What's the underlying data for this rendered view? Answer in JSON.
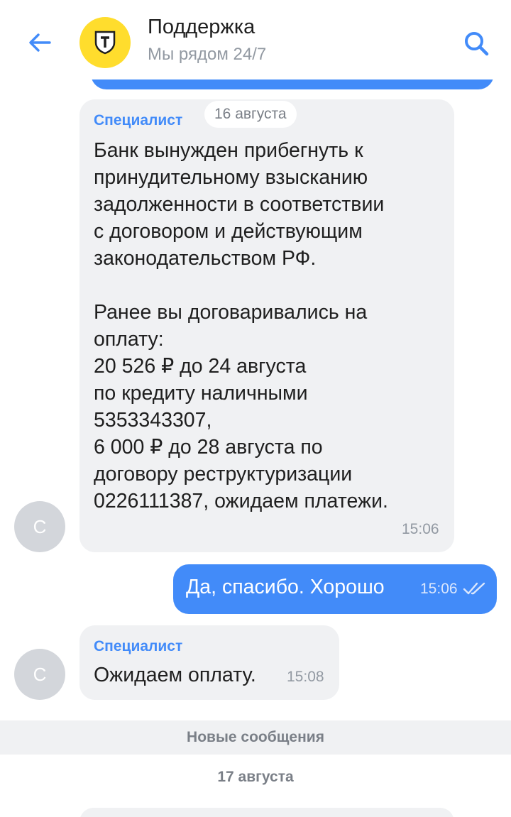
{
  "header": {
    "title": "Поддержка",
    "subtitle": "Мы рядом 24/7",
    "back_icon": "arrow-left-icon",
    "search_icon": "search-icon",
    "logo_icon": "tinkoff-shield-icon"
  },
  "colors": {
    "accent": "#428bf9",
    "bubble_in": "#f0f1f3",
    "logo_bg": "#ffdd2d",
    "avatar_bg": "#d3d6db"
  },
  "messages": [
    {
      "sender": "Специалист",
      "date_chip": "16 августа",
      "text": "Банк вынужден прибегнуть к\nпринудительному взысканию\nзадолженности в соответствии\nс договором и действующим\nзаконодательством РФ.\n\nРанее вы договаривались на\nоплату:\n20 526 ₽ до 24 августа\nпо кредиту наличными\n5353343307,\n6 000 ₽ до 28 августа по\nдоговору реструктуризации\n0226111387, ожидаем платежи.",
      "time": "15:06",
      "avatar": "С"
    },
    {
      "outgoing": true,
      "text": "Да, спасибо. Хорошо",
      "time": "15:06",
      "status_icon": "double-check-icon"
    },
    {
      "sender": "Специалист",
      "text": "Ожидаем оплату.",
      "time": "15:08",
      "avatar": "С"
    }
  ],
  "divider": {
    "new_messages": "Новые сообщения",
    "day": "17 августа"
  }
}
